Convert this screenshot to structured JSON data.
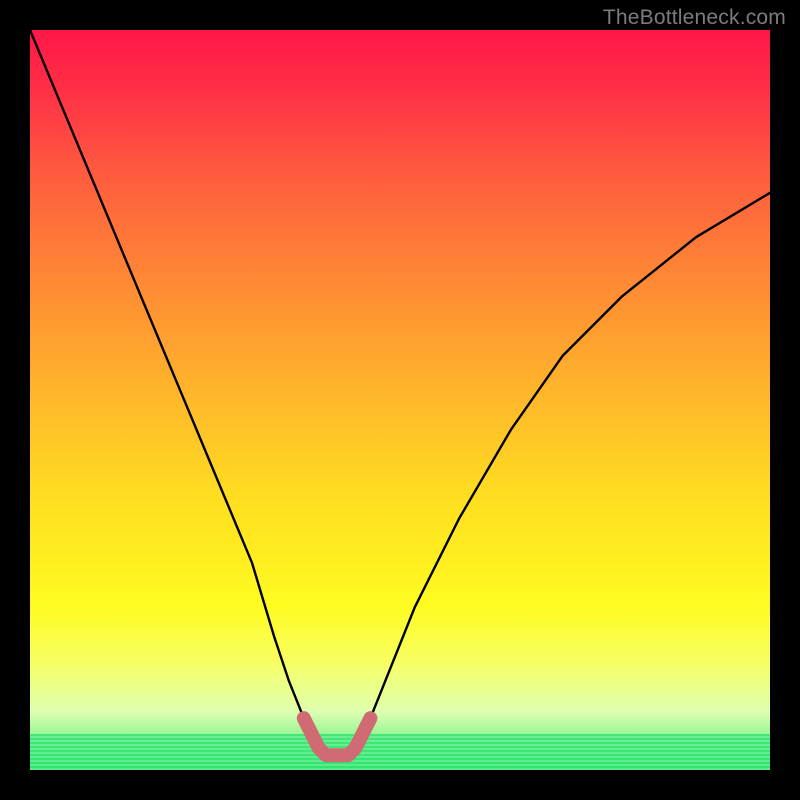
{
  "watermark": {
    "text": "TheBottleneck.com"
  },
  "chart_data": {
    "type": "line",
    "title": "",
    "xlabel": "",
    "ylabel": "",
    "xlim": [
      0,
      100
    ],
    "ylim": [
      0,
      100
    ],
    "series": [
      {
        "name": "bottleneck-curve",
        "x": [
          0,
          5,
          10,
          15,
          20,
          25,
          30,
          33,
          35,
          37,
          39,
          40,
          41,
          42,
          43,
          44,
          46,
          48,
          52,
          58,
          65,
          72,
          80,
          90,
          100
        ],
        "values": [
          100,
          88,
          76,
          64,
          52,
          40,
          28,
          18,
          12,
          7,
          3,
          2,
          2,
          2,
          2,
          3,
          7,
          12,
          22,
          34,
          46,
          56,
          64,
          72,
          78
        ]
      },
      {
        "name": "highlight-bottom",
        "x": [
          37,
          39,
          40,
          41,
          42,
          43,
          44,
          46
        ],
        "values": [
          7,
          3,
          2,
          2,
          2,
          2,
          3,
          7
        ]
      }
    ],
    "annotations": []
  },
  "colors": {
    "curve": "#000000",
    "highlight": "#d16b73",
    "watermark": "#7c7c7c"
  }
}
